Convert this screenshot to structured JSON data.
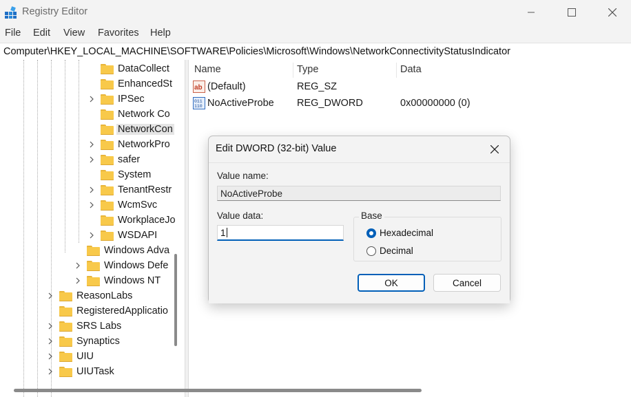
{
  "window": {
    "title": "Registry Editor"
  },
  "menu": [
    "File",
    "Edit",
    "View",
    "Favorites",
    "Help"
  ],
  "address": "Computer\\HKEY_LOCAL_MACHINE\\SOFTWARE\\Policies\\Microsoft\\Windows\\NetworkConnectivityStatusIndicator",
  "tree": {
    "items": [
      {
        "label": "DataCollect"
      },
      {
        "label": "EnhancedSt"
      },
      {
        "label": "IPSec"
      },
      {
        "label": "Network Co"
      },
      {
        "label": "NetworkCon"
      },
      {
        "label": "NetworkPro"
      },
      {
        "label": "safer"
      },
      {
        "label": "System"
      },
      {
        "label": "TenantRestr"
      },
      {
        "label": "WcmSvc"
      },
      {
        "label": "WorkplaceJo"
      },
      {
        "label": "WSDAPI"
      },
      {
        "label": "Windows Adva"
      },
      {
        "label": "Windows Defe"
      },
      {
        "label": "Windows NT"
      },
      {
        "label": "ReasonLabs"
      },
      {
        "label": "RegisteredApplicatio"
      },
      {
        "label": "SRS Labs"
      },
      {
        "label": "Synaptics"
      },
      {
        "label": "UIU"
      },
      {
        "label": "UIUTask"
      }
    ]
  },
  "list": {
    "columns": [
      "Name",
      "Type",
      "Data"
    ],
    "rows": [
      {
        "name": "(Default)",
        "type": "REG_SZ",
        "data": "",
        "icon": "string-value-icon"
      },
      {
        "name": "NoActiveProbe",
        "type": "REG_DWORD",
        "data": "0x00000000 (0)",
        "icon": "binary-value-icon"
      }
    ]
  },
  "dialog": {
    "title": "Edit DWORD (32-bit) Value",
    "value_name_label": "Value name:",
    "value_name": "NoActiveProbe",
    "value_data_label": "Value data:",
    "value_data": "1",
    "base_label": "Base",
    "base_options": [
      "Hexadecimal",
      "Decimal"
    ],
    "base_selected": "Hexadecimal",
    "ok_label": "OK",
    "cancel_label": "Cancel"
  },
  "colors": {
    "accent": "#005fb8",
    "folder": "#f8c94a"
  }
}
